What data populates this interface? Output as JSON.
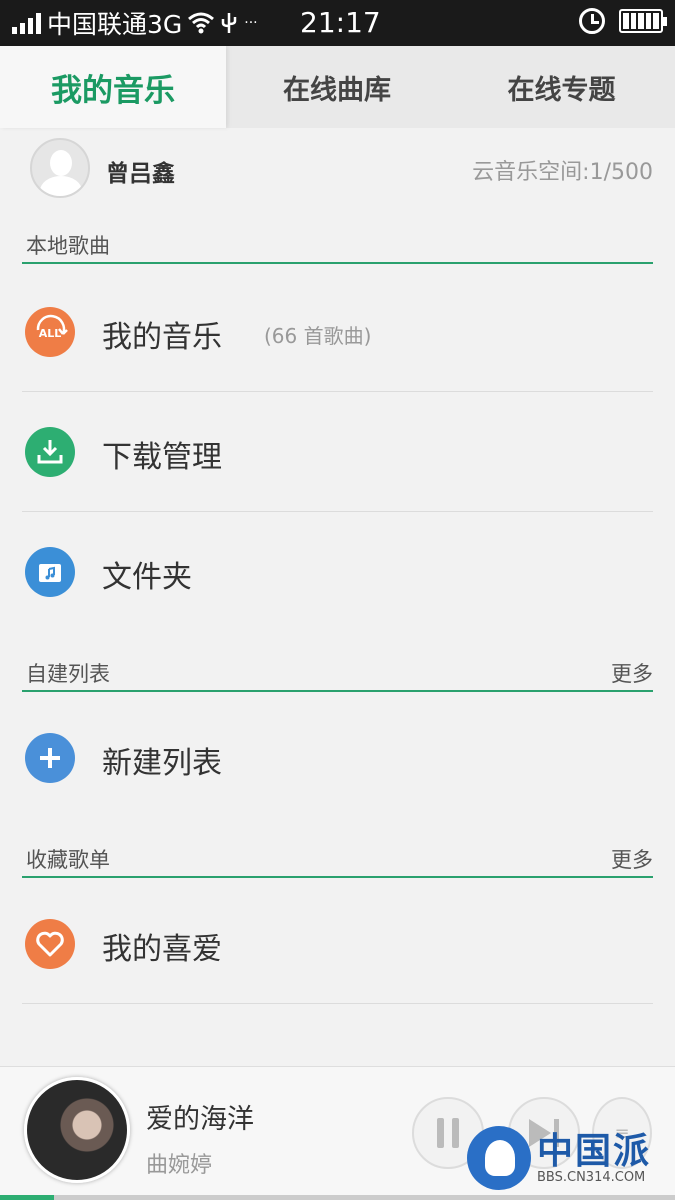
{
  "status_bar": {
    "carrier": "中国联通3G",
    "time": "21:17",
    "extra": "···"
  },
  "tabs": [
    {
      "label": "我的音乐",
      "active": true
    },
    {
      "label": "在线曲库",
      "active": false
    },
    {
      "label": "在线专题",
      "active": false
    }
  ],
  "profile": {
    "username": "曾吕鑫",
    "cloud_space": "云音乐空间:1/500"
  },
  "local_section": {
    "title": "本地歌曲",
    "items": [
      {
        "label": "我的音乐",
        "count": "(66 首歌曲)",
        "icon": "all-icon"
      },
      {
        "label": "下载管理",
        "icon": "download-icon"
      },
      {
        "label": "文件夹",
        "icon": "folder-music-icon"
      }
    ]
  },
  "custom_section": {
    "title": "自建列表",
    "more": "更多",
    "items": [
      {
        "label": "新建列表",
        "icon": "plus-icon"
      }
    ]
  },
  "fav_section": {
    "title": "收藏歌单",
    "more": "更多",
    "items": [
      {
        "label": "我的喜爱",
        "icon": "heart-icon"
      }
    ]
  },
  "player": {
    "song_title": "爱的海洋",
    "artist": "曲婉婷",
    "progress": 0.08
  },
  "watermark": {
    "text": "中国派",
    "sub": "BBS.CN314.COM"
  },
  "colors": {
    "accent": "#1b9a63",
    "divider_line": "#2aa16e",
    "orange": "#ef7d46",
    "green": "#2dae72",
    "blue": "#3b8fd7"
  }
}
